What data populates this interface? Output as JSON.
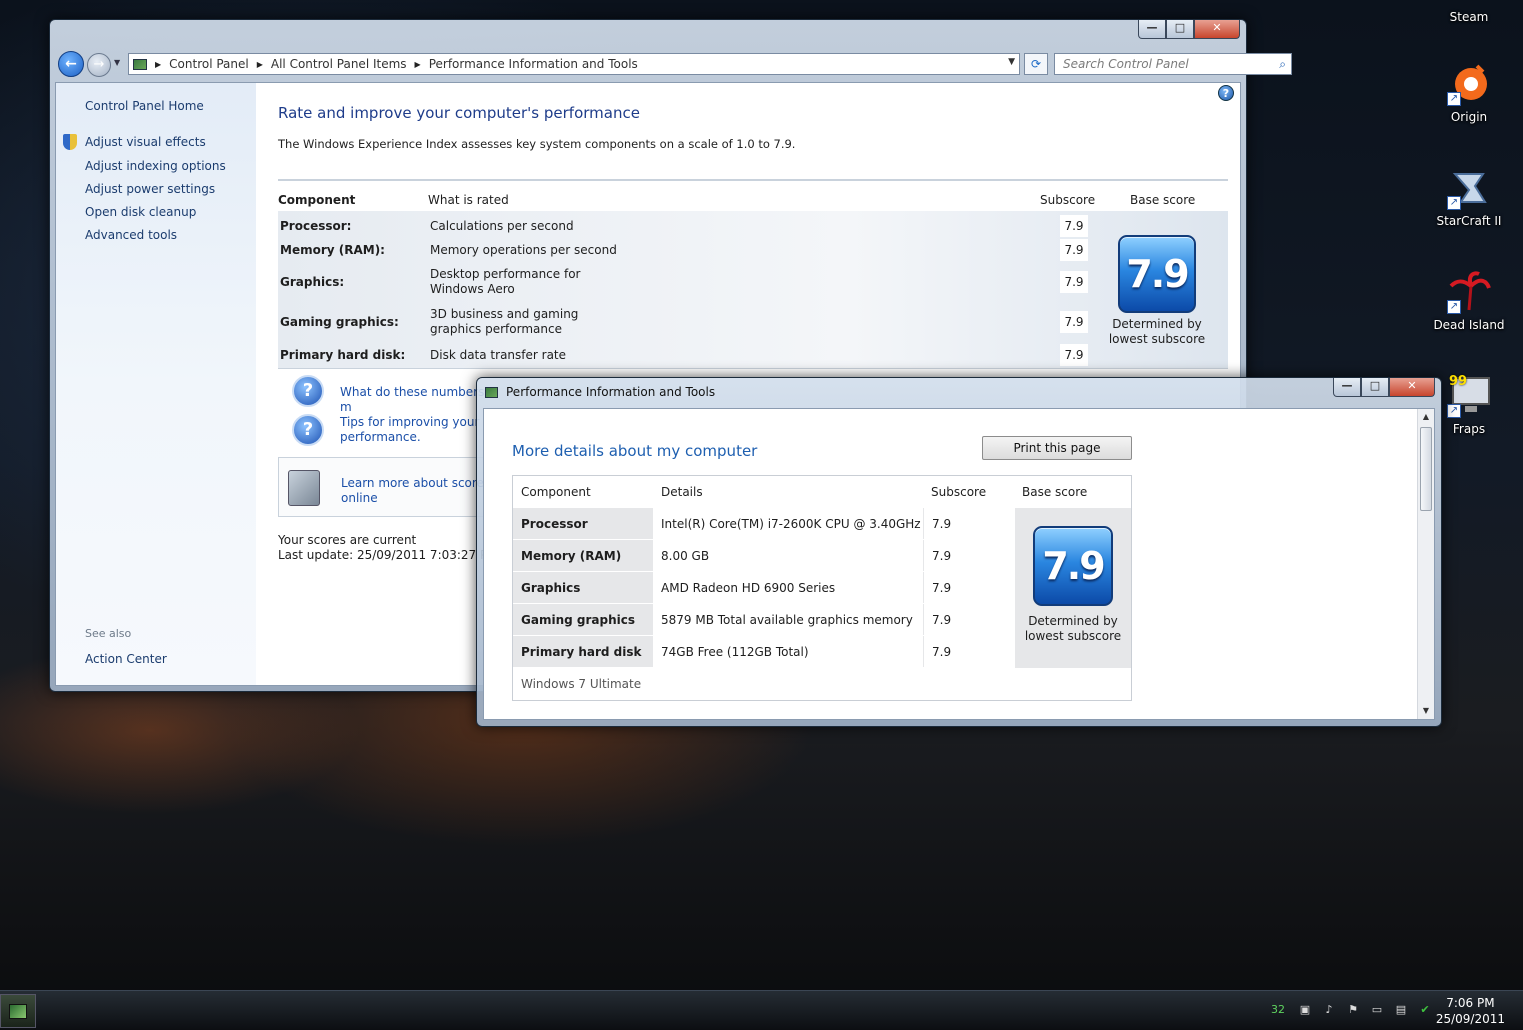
{
  "desktop": {
    "icons": [
      {
        "label": "Steam",
        "glyph": "steam-icon"
      },
      {
        "label": "Origin",
        "glyph": "origin-icon"
      },
      {
        "label": "StarCraft II",
        "glyph": "starcraft-icon"
      },
      {
        "label": "Dead Island",
        "glyph": "dead-island-icon"
      },
      {
        "label": "Fraps",
        "glyph": "fraps-icon",
        "badge": "99"
      }
    ]
  },
  "main_window": {
    "nav": {
      "breadcrumb": [
        "Control Panel",
        "All Control Panel Items",
        "Performance Information and Tools"
      ],
      "search_placeholder": "Search Control Panel"
    },
    "sidebar": {
      "home": "Control Panel Home",
      "items": [
        "Adjust visual effects",
        "Adjust indexing options",
        "Adjust power settings",
        "Open disk cleanup",
        "Advanced tools"
      ],
      "see_also_label": "See also",
      "see_also_items": [
        "Action Center"
      ]
    },
    "content": {
      "title": "Rate and improve your computer's performance",
      "intro": "The Windows Experience Index assesses key system components on a scale of 1.0 to 7.9.",
      "table": {
        "headers": {
          "component": "Component",
          "rated": "What is rated",
          "subscore": "Subscore",
          "base": "Base score"
        },
        "rows": [
          {
            "component": "Processor:",
            "rated": "Calculations per second",
            "subscore": "7.9"
          },
          {
            "component": "Memory (RAM):",
            "rated": "Memory operations per second",
            "subscore": "7.9"
          },
          {
            "component": "Graphics:",
            "rated": "Desktop performance for Windows Aero",
            "subscore": "7.9"
          },
          {
            "component": "Gaming graphics:",
            "rated": "3D business and gaming graphics performance",
            "subscore": "7.9"
          },
          {
            "component": "Primary hard disk:",
            "rated": "Disk data transfer rate",
            "subscore": "7.9"
          }
        ],
        "base_score": "7.9",
        "base_caption": "Determined by lowest subscore"
      },
      "links": [
        {
          "text": "What do these numbers m"
        },
        {
          "text": "Tips for improving your c performance."
        }
      ],
      "learn_more": "Learn more about scores online",
      "status_line1": "Your scores are current",
      "status_line2": "Last update: 25/09/2011 7:03:27 PM"
    }
  },
  "details_window": {
    "title": "Performance Information and Tools",
    "heading": "More details about my computer",
    "print_button": "Print this page",
    "table": {
      "headers": {
        "component": "Component",
        "details": "Details",
        "subscore": "Subscore",
        "base": "Base score"
      },
      "rows": [
        {
          "component": "Processor",
          "details": "Intel(R) Core(TM) i7-2600K CPU @ 3.40GHz",
          "subscore": "7.9"
        },
        {
          "component": "Memory (RAM)",
          "details": "8.00 GB",
          "subscore": "7.9"
        },
        {
          "component": "Graphics",
          "details": "AMD Radeon HD 6900 Series",
          "subscore": "7.9"
        },
        {
          "component": "Gaming graphics",
          "details": "5879 MB Total available graphics memory",
          "subscore": "7.9"
        },
        {
          "component": "Primary hard disk",
          "details": "74GB Free (112GB Total)",
          "subscore": "7.9"
        }
      ],
      "base_score": "7.9",
      "base_caption": "Determined by lowest subscore",
      "os": "Windows 7 Ultimate"
    }
  },
  "taskbar": {
    "tray_number": "32",
    "time": "7:06 PM",
    "date": "25/09/2011"
  },
  "colors": {
    "accent": "#1e5fb0",
    "link": "#1b4fa8"
  }
}
